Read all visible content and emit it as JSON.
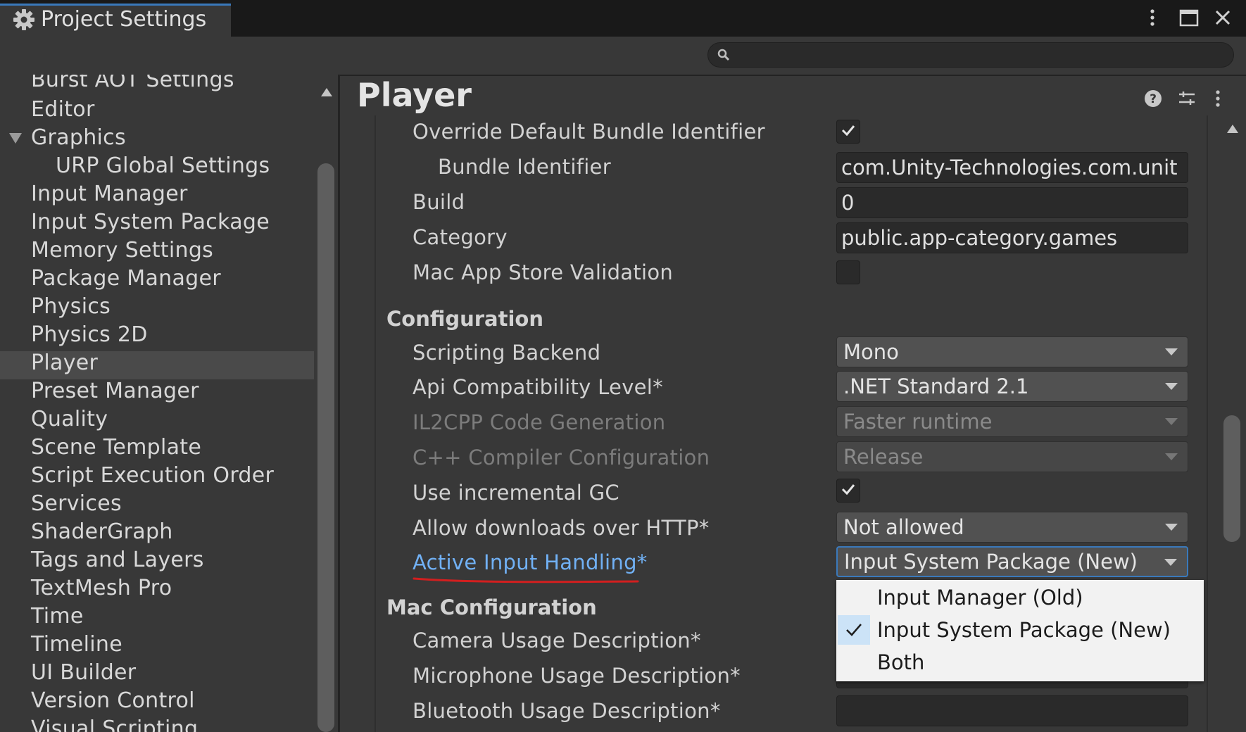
{
  "window": {
    "tab_title": "Project Settings"
  },
  "search": {
    "placeholder": ""
  },
  "sidebar": {
    "items": [
      {
        "label": "Burst AOT Settings"
      },
      {
        "label": "Editor"
      },
      {
        "label": "Graphics"
      },
      {
        "label": "URP Global Settings"
      },
      {
        "label": "Input Manager"
      },
      {
        "label": "Input System Package"
      },
      {
        "label": "Memory Settings"
      },
      {
        "label": "Package Manager"
      },
      {
        "label": "Physics"
      },
      {
        "label": "Physics 2D"
      },
      {
        "label": "Player"
      },
      {
        "label": "Preset Manager"
      },
      {
        "label": "Quality"
      },
      {
        "label": "Scene Template"
      },
      {
        "label": "Script Execution Order"
      },
      {
        "label": "Services"
      },
      {
        "label": "ShaderGraph"
      },
      {
        "label": "Tags and Layers"
      },
      {
        "label": "TextMesh Pro"
      },
      {
        "label": "Time"
      },
      {
        "label": "Timeline"
      },
      {
        "label": "UI Builder"
      },
      {
        "label": "Version Control"
      },
      {
        "label": "Visual Scripting"
      }
    ],
    "selected": "Player"
  },
  "main": {
    "title": "Player",
    "rows": {
      "override_bundle": {
        "label": "Override Default Bundle Identifier",
        "checked": true
      },
      "bundle_id": {
        "label": "Bundle Identifier",
        "value": "com.Unity-Technologies.com.unit"
      },
      "build": {
        "label": "Build",
        "value": "0"
      },
      "category": {
        "label": "Category",
        "value": "public.app-category.games"
      },
      "mac_validation": {
        "label": "Mac App Store Validation",
        "checked": false
      }
    },
    "configuration": {
      "header": "Configuration",
      "scripting_backend": {
        "label": "Scripting Backend",
        "value": "Mono"
      },
      "api_level": {
        "label": "Api Compatibility Level*",
        "value": ".NET Standard 2.1"
      },
      "il2cpp_codegen": {
        "label": "IL2CPP Code Generation",
        "value": "Faster runtime"
      },
      "cpp_compiler": {
        "label": "C++ Compiler Configuration",
        "value": "Release"
      },
      "incremental_gc": {
        "label": "Use incremental GC",
        "checked": true
      },
      "http_downloads": {
        "label": "Allow downloads over HTTP*",
        "value": "Not allowed"
      },
      "active_input": {
        "label": "Active Input Handling*",
        "value": "Input System Package (New)"
      }
    },
    "mac_configuration": {
      "header": "Mac Configuration",
      "camera": {
        "label": "Camera Usage Description*"
      },
      "microphone": {
        "label": "Microphone Usage Description*"
      },
      "bluetooth": {
        "label": "Bluetooth Usage Description*"
      }
    }
  },
  "popup": {
    "options": [
      "Input Manager (Old)",
      "Input System Package (New)",
      "Both"
    ],
    "selected": "Input System Package (New)"
  },
  "colors": {
    "accent": "#3a79bb",
    "link": "#71b1f5",
    "annotation": "#d21f1f"
  }
}
